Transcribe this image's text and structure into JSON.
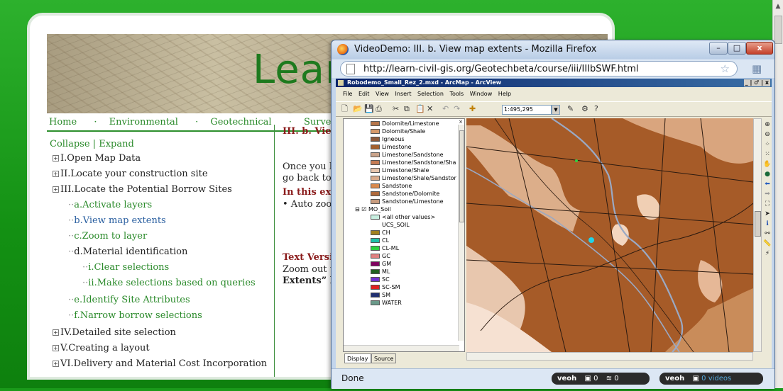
{
  "page": {
    "banner_title": "Learn",
    "nav": [
      "Home",
      "Environmental",
      "Geotechnical",
      "Survey"
    ],
    "nav_sep": "·",
    "toc": {
      "collapse": "Collapse",
      "pipe": "|",
      "expand": "Expand",
      "items": [
        "I.Open Map Data",
        "II.Locate your construction site",
        "III.Locate the Potential Borrow Sites",
        "a.Activate layers",
        "b.View map extents",
        "c.Zoom to layer",
        "d.Material identification",
        "i.Clear selections",
        "ii.Make selections based on queries",
        "e.Identify Site Attributes",
        "f.Narrow borrow selections",
        "IV.Detailed site selection",
        "V.Creating a layout",
        "VI.Delivery and Material Cost Incorporation"
      ]
    },
    "content": {
      "title": "III. b. View",
      "p1a": "Once you h",
      "p1b": "go back to v",
      "subhead": "In this exe",
      "bullet": "• Auto zoom",
      "text_version": "Text Versi",
      "t1": "Zoom out to",
      "t2": "Extents” b"
    }
  },
  "firefox": {
    "title": "VideoDemo: III. b. View map extents - Mozilla Firefox",
    "url": "http://learn-civil-gis.org/Geotechbeta/course/iii/IIIbSWF.html",
    "min": "–",
    "max": "□",
    "close": "x",
    "status": "Done",
    "veoh1": {
      "brand": "veoh",
      "a": "0",
      "b": "0"
    },
    "veoh2": {
      "brand": "veoh",
      "count": "0",
      "videos": "videos"
    }
  },
  "arcmap": {
    "title": "Robodemo_Small_Rez_2.mxd - ArcMap - ArcView",
    "title_btns": "_ | ♂ | x",
    "menu": [
      "File",
      "Edit",
      "View",
      "Insert",
      "Selection",
      "Tools",
      "Window",
      "Help"
    ],
    "scale": "1:495,295",
    "legend": [
      {
        "label": "Dolomite/Limestone",
        "color": "#b5754a"
      },
      {
        "label": "Dolomite/Shale",
        "color": "#d69a6b"
      },
      {
        "label": "Igneous",
        "color": "#8e5a3a"
      },
      {
        "label": "Limestone",
        "color": "#a4602d"
      },
      {
        "label": "Limestone/Sandstone",
        "color": "#c9a38a"
      },
      {
        "label": "Limestone/Sandstone/Sha",
        "color": "#c47c55"
      },
      {
        "label": "Limestone/Shale",
        "color": "#e7c5ad"
      },
      {
        "label": "Limestone/Shale/Sandstor",
        "color": "#d9ab8c"
      },
      {
        "label": "Sandstone",
        "color": "#d98a4e"
      },
      {
        "label": "Sandstone/Dolomite",
        "color": "#b06a3c"
      },
      {
        "label": "Sandstone/Limestone",
        "color": "#c79b7e"
      }
    ],
    "soil_layer": "MO_Soil",
    "soil_other": "<all other values>",
    "soil_field": "UCS_SOIL",
    "soil_legend": [
      {
        "label": "CH",
        "color": "#a08020"
      },
      {
        "label": "CL",
        "color": "#20c0a8"
      },
      {
        "label": "CL-ML",
        "color": "#30d040"
      },
      {
        "label": "GC",
        "color": "#e08080"
      },
      {
        "label": "GM",
        "color": "#800060"
      },
      {
        "label": "ML",
        "color": "#206020"
      },
      {
        "label": "SC",
        "color": "#7030d0"
      },
      {
        "label": "SC-SM",
        "color": "#e02020"
      },
      {
        "label": "SM",
        "color": "#203070"
      },
      {
        "label": "WATER",
        "color": "#6a9a8a"
      }
    ],
    "tab_display": "Display",
    "tab_source": "Source"
  },
  "video": {
    "controls": "⏮ ◀◀ ▶ ❚❚ ▶▶ ⏭",
    "info": "i"
  }
}
